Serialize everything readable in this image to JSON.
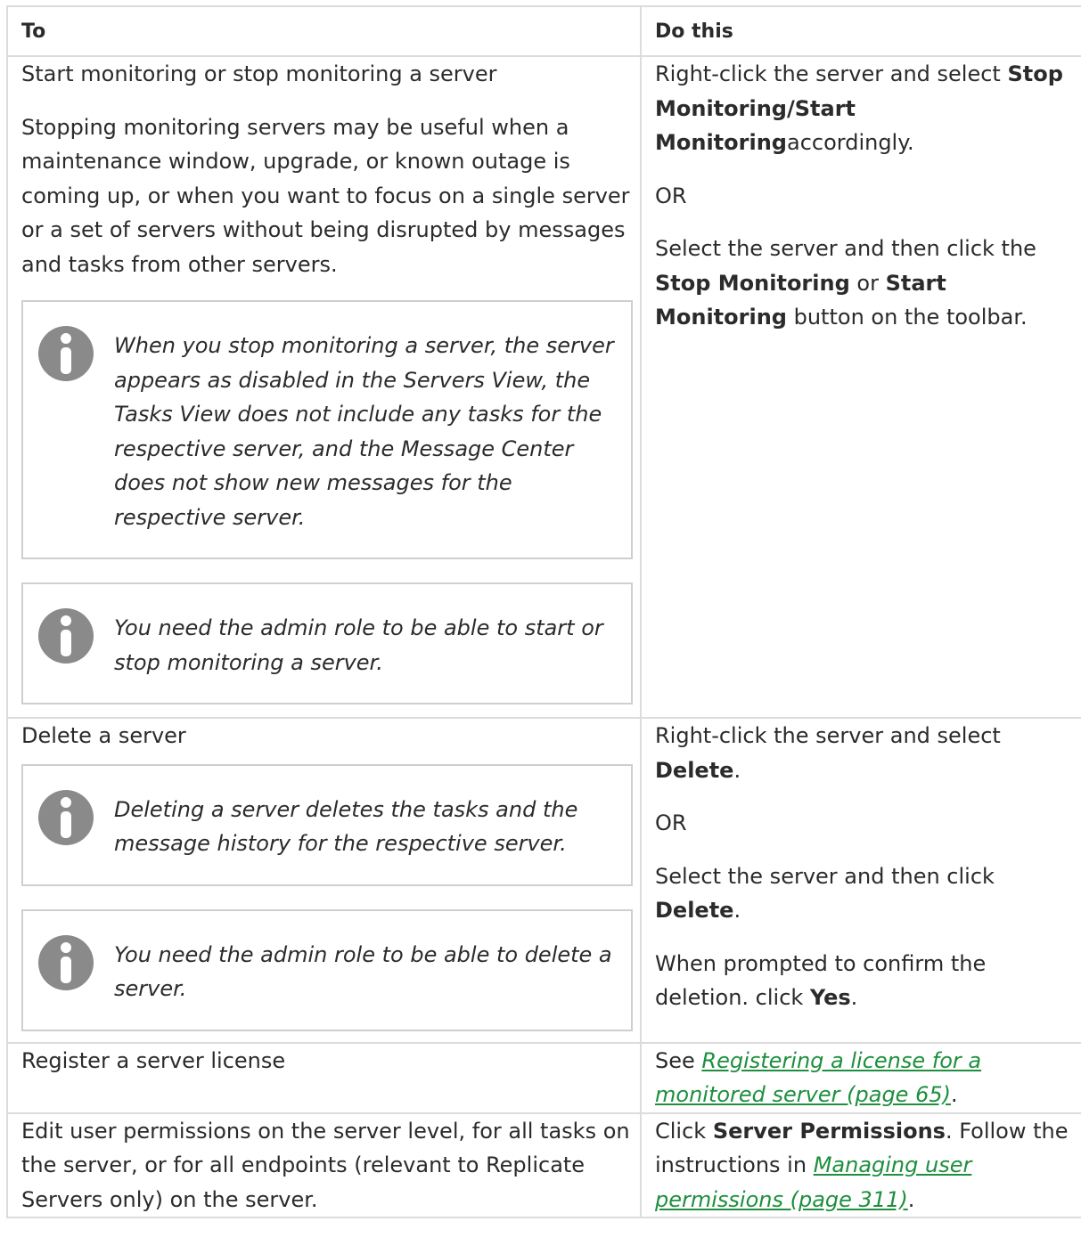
{
  "headers": {
    "to": "To",
    "do_this": "Do this"
  },
  "rows": [
    {
      "to": {
        "title": "Start monitoring or stop monitoring a server",
        "desc": "Stopping monitoring servers may be useful when a maintenance window, upgrade, or known outage is coming up, or when you want to focus on a single server or a set of servers without being disrupted by messages and tasks from other servers.",
        "notes": [
          "When you stop monitoring a server, the server appears as disabled in the Servers View, the Tasks View does not include any tasks for the respective server, and the Message Center does not show new messages for the respective server.",
          "You need the admin role to be able to start or stop monitoring a server."
        ]
      },
      "do": {
        "p1_pre": "Right-click the server and select ",
        "p1_bold": "Stop Monitoring/Start Monitoring",
        "p1_post": "accordingly.",
        "or": "OR",
        "p2_pre": "Select the server and then click the ",
        "p2_bold1": "Stop Monitoring",
        "p2_mid": " or ",
        "p2_bold2": "Start Monitoring",
        "p2_post": " button on the toolbar."
      }
    },
    {
      "to": {
        "title": "Delete a server",
        "notes": [
          "Deleting a server deletes the tasks and the message history for the respective server.",
          "You need the admin role to be able to delete a server."
        ]
      },
      "do": {
        "p1_pre": "Right-click the server and select ",
        "p1_bold": "Delete",
        "p1_post": ".",
        "or": "OR",
        "p2_pre": "Select the server and then click ",
        "p2_bold": "Delete",
        "p2_post": ".",
        "p3_pre": "When prompted to confirm the deletion. click ",
        "p3_bold": "Yes",
        "p3_post": "."
      }
    },
    {
      "to": {
        "title": "Register a server license"
      },
      "do": {
        "pre": "See ",
        "link": "Registering a license for a monitored server (page 65)",
        "post": "."
      }
    },
    {
      "to": {
        "title": "Edit user permissions on the server level, for all tasks on the server, or for all endpoints (relevant to Replicate Servers only) on the server."
      },
      "do": {
        "pre": "Click ",
        "bold": "Server Permissions",
        "mid": ". Follow the instructions in ",
        "link": "Managing user permissions (page 311)",
        "post": "."
      }
    }
  ],
  "icons": {
    "note": "info-icon"
  },
  "colors": {
    "link": "#1e8f3e",
    "border": "#dcdcdc",
    "icon": "#8a8a8a"
  }
}
